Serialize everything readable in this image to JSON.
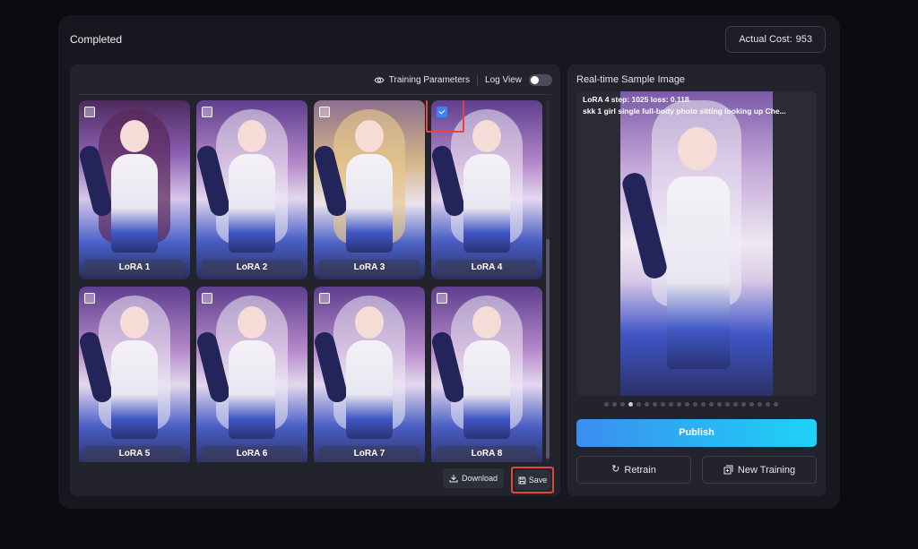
{
  "status": {
    "text": "Completed"
  },
  "cost": {
    "label": "Actual Cost:",
    "value": "953"
  },
  "toolbar": {
    "training_params_label": "Training Parameters",
    "log_view_label": "Log View",
    "log_view_on": false
  },
  "thumbnails": [
    {
      "label": "LoRA 1",
      "selected": false
    },
    {
      "label": "LoRA 2",
      "selected": false
    },
    {
      "label": "LoRA 3",
      "selected": false
    },
    {
      "label": "LoRA 4",
      "selected": true
    },
    {
      "label": "LoRA 5",
      "selected": false
    },
    {
      "label": "LoRA 6",
      "selected": false
    },
    {
      "label": "LoRA 7",
      "selected": false
    },
    {
      "label": "LoRA 8",
      "selected": false
    }
  ],
  "actions": {
    "download_label": "Download",
    "save_label": "Save"
  },
  "sample": {
    "title": "Real-time Sample Image",
    "overlay_line1": "LoRA 4 step: 1025 loss: 0.118",
    "overlay_line2": "skk 1 girl single full-body photo sitting looking up Che..."
  },
  "right_actions": {
    "publish_label": "Publish",
    "retrain_label": "Retrain",
    "new_training_label": "New Training"
  },
  "colors": {
    "accent_start": "#3a8ef0",
    "accent_end": "#1ed3f6",
    "highlight": "#e2453c"
  }
}
